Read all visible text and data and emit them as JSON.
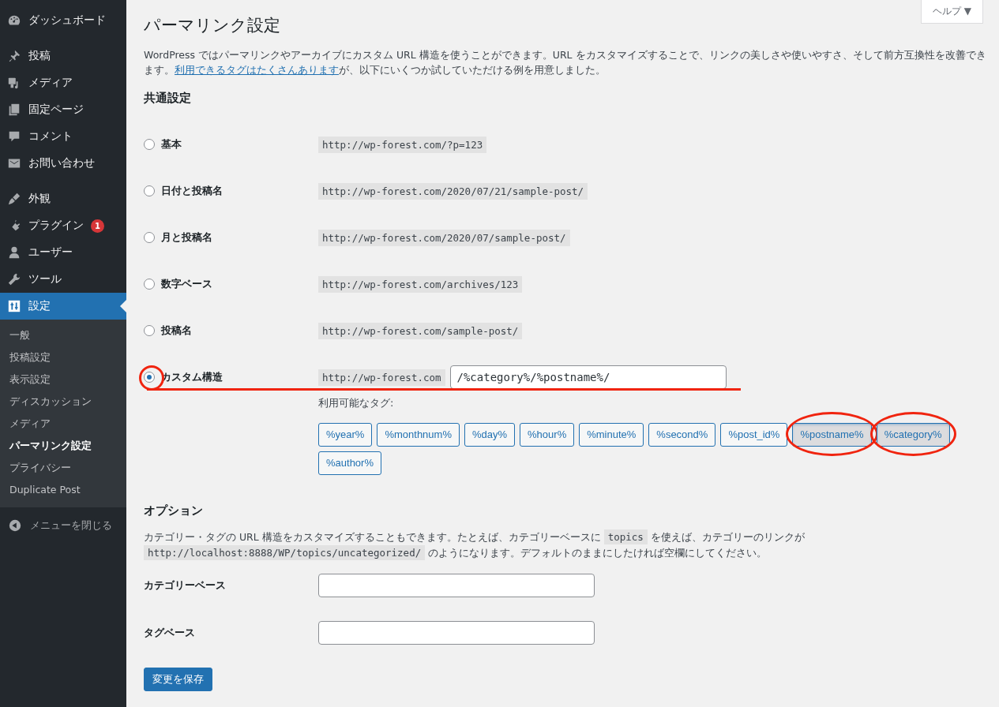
{
  "sidebar": {
    "groups": [
      {
        "items": [
          {
            "label": "ダッシュボード",
            "selected": false
          }
        ]
      },
      {
        "items": [
          {
            "label": "投稿",
            "selected": false
          },
          {
            "label": "メディア",
            "selected": false
          },
          {
            "label": "固定ページ",
            "selected": false
          },
          {
            "label": "コメント",
            "selected": false
          },
          {
            "label": "お問い合わせ",
            "selected": false
          }
        ]
      },
      {
        "items": [
          {
            "label": "外観",
            "selected": false
          },
          {
            "label": "プラグイン",
            "selected": false,
            "badge": "1"
          },
          {
            "label": "ユーザー",
            "selected": false
          },
          {
            "label": "ツール",
            "selected": false
          },
          {
            "label": "設定",
            "selected": true
          }
        ]
      }
    ],
    "submenu": [
      {
        "label": "一般",
        "selected": false
      },
      {
        "label": "投稿設定",
        "selected": false
      },
      {
        "label": "表示設定",
        "selected": false
      },
      {
        "label": "ディスカッション",
        "selected": false
      },
      {
        "label": "メディア",
        "selected": false
      },
      {
        "label": "パーマリンク設定",
        "selected": true
      },
      {
        "label": "プライバシー",
        "selected": false
      },
      {
        "label": "Duplicate Post",
        "selected": false
      }
    ],
    "collapse": "メニューを閉じる"
  },
  "help_button": "ヘルプ ▼",
  "title": "パーマリンク設定",
  "intro": [
    {
      "kind": "text",
      "text": "WordPress ではパーマリンクやアーカイブにカスタム URL 構造を使うことができます。URL をカスタマイズすることで、リンクの美しさや使いやすさ、そして前方互換性を改善できます。"
    },
    {
      "kind": "link",
      "text": "利用できるタグはたくさんあります"
    },
    {
      "kind": "text",
      "text": "が、以下にいくつか試していただける例を用意しました。"
    }
  ],
  "common_heading": "共通設定",
  "options": [
    {
      "label": "基本",
      "url": "http://wp-forest.com/?p=123",
      "selected": false,
      "highlighted": false
    },
    {
      "label": "日付と投稿名",
      "url": "http://wp-forest.com/2020/07/21/sample-post/",
      "selected": false,
      "highlighted": false
    },
    {
      "label": "月と投稿名",
      "url": "http://wp-forest.com/2020/07/sample-post/",
      "selected": false,
      "highlighted": false
    },
    {
      "label": "数字ベース",
      "url": "http://wp-forest.com/archives/123",
      "selected": false,
      "highlighted": false
    },
    {
      "label": "投稿名",
      "url": "http://wp-forest.com/sample-post/",
      "selected": false,
      "highlighted": false
    },
    {
      "label": "カスタム構造",
      "url": "http://wp-forest.com",
      "value": "/%category%/%postname%/",
      "selected": true,
      "highlighted": true
    }
  ],
  "tags_label": "利用可能なタグ:",
  "tags": [
    {
      "label": "%year%",
      "selected": false,
      "highlighted": false
    },
    {
      "label": "%monthnum%",
      "selected": false,
      "highlighted": false
    },
    {
      "label": "%day%",
      "selected": false,
      "highlighted": false
    },
    {
      "label": "%hour%",
      "selected": false,
      "highlighted": false
    },
    {
      "label": "%minute%",
      "selected": false,
      "highlighted": false
    },
    {
      "label": "%second%",
      "selected": false,
      "highlighted": false
    },
    {
      "label": "%post_id%",
      "selected": false,
      "highlighted": false
    },
    {
      "label": "%postname%",
      "selected": true,
      "highlighted": true
    },
    {
      "label": "%category%",
      "selected": true,
      "highlighted": true
    },
    {
      "label": "%author%",
      "selected": false,
      "highlighted": false
    }
  ],
  "options_heading": "オプション",
  "options_text": [
    {
      "kind": "text",
      "text": "カテゴリー・タグの URL 構造をカスタマイズすることもできます。たとえば、カテゴリーベースに "
    },
    {
      "kind": "code",
      "text": "topics"
    },
    {
      "kind": "text",
      "text": " を使えば、カテゴリーのリンクが "
    },
    {
      "kind": "code",
      "text": "http://localhost:8888/WP/topics/uncategorized/"
    },
    {
      "kind": "text",
      "text": " のようになります。デフォルトのままにしたければ空欄にしてください。"
    }
  ],
  "fields": [
    {
      "label": "カテゴリーベース"
    },
    {
      "label": "タグベース"
    }
  ],
  "save_button": "変更を保存"
}
